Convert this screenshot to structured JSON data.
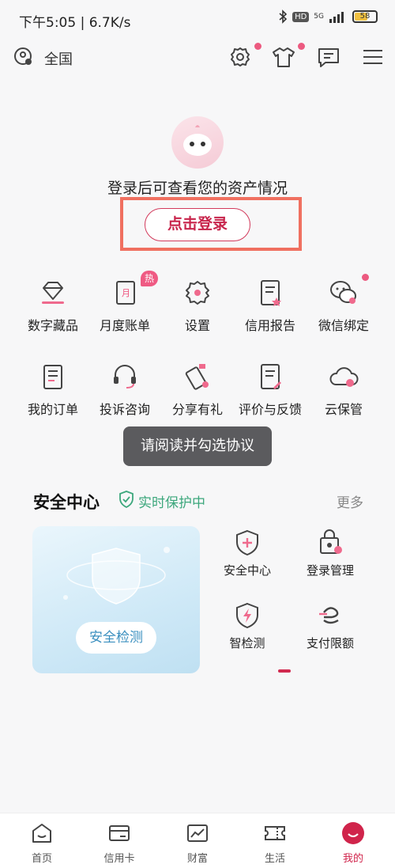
{
  "status_bar": {
    "time": "下午5:05 | 6.7K/s",
    "hd": "HD",
    "network": "5G",
    "battery": "58"
  },
  "top_nav": {
    "location": "全国"
  },
  "login": {
    "hint": "登录后可查看您的资产情况",
    "button": "点击登录"
  },
  "grid": {
    "row1": [
      "数字藏品",
      "月度账单",
      "设置",
      "信用报告",
      "微信绑定"
    ],
    "row2": [
      "我的订单",
      "投诉咨询",
      "分享有礼",
      "评价与反馈",
      "云保管"
    ],
    "hot_badge": "热"
  },
  "toast": "请阅读并勾选协议",
  "security": {
    "title": "安全中心",
    "status": "实时保护中",
    "more": "更多",
    "check_button": "安全检测",
    "items": [
      "安全中心",
      "登录管理",
      "智检测",
      "支付限额"
    ]
  },
  "bottom_nav": {
    "tabs": [
      "首页",
      "信用卡",
      "财富",
      "生活",
      "我的"
    ],
    "active": "我的"
  },
  "colors": {
    "accent": "#d0244b",
    "badge": "#ef5a83",
    "secure": "#3ca77c"
  }
}
